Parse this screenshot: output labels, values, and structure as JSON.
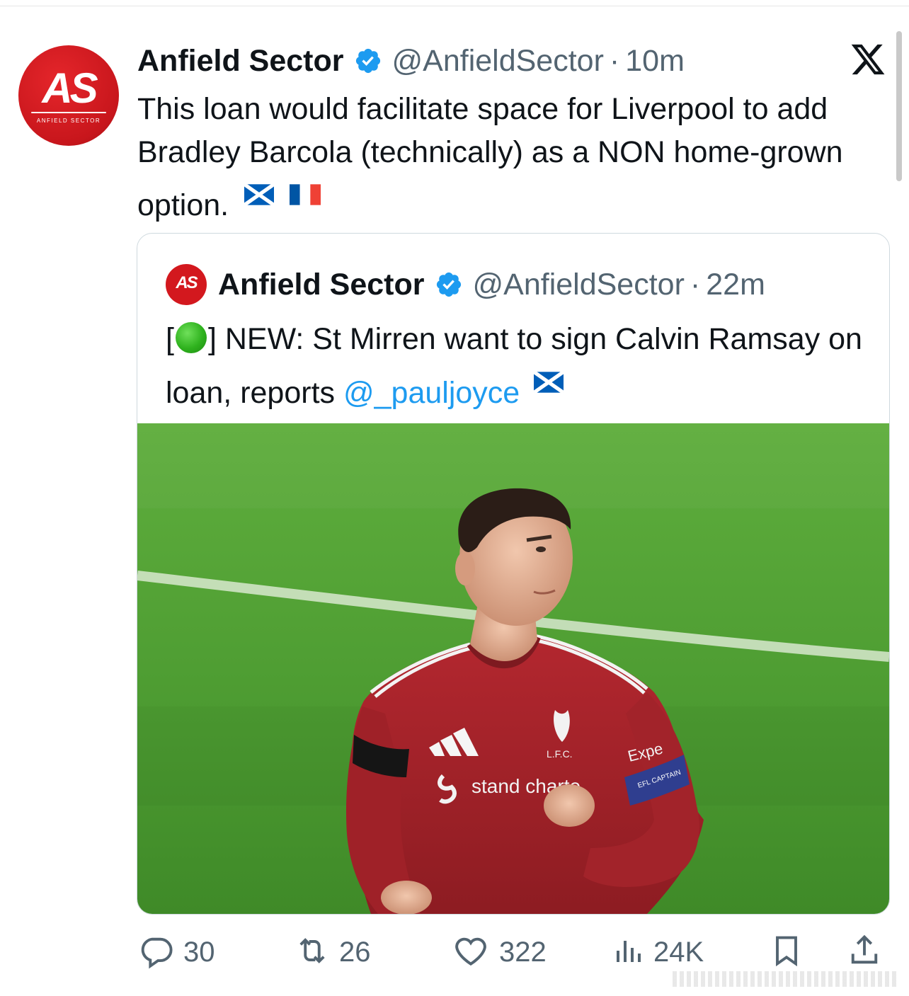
{
  "tweet": {
    "author": {
      "display_name": "Anfield Sector",
      "handle": "@AnfieldSector",
      "avatar_text": "AS",
      "avatar_subtext": "ANFIELD SECTOR"
    },
    "separator": "·",
    "time": "10m",
    "text": "This loan would facilitate space for Liverpool to add Bradley Barcola (technically) as a NON home-grown option.",
    "flags": [
      "scotland-flag",
      "france-flag"
    ]
  },
  "quoted_tweet": {
    "author": {
      "display_name": "Anfield Sector",
      "handle": "@AnfieldSector",
      "avatar_text": "AS"
    },
    "separator": "·",
    "time": "22m",
    "text_prefix_open": "[",
    "text_prefix_close": "] NEW: St Mirren want to sign Calvin Ramsay on loan, reports ",
    "mention": "@_pauljoyce",
    "flag": "scotland-flag",
    "image": {
      "shirt_sponsor": "stand charte",
      "crest_text": "L.F.C.",
      "sleeve_sponsor": "Expe",
      "armband_text": "EFL CAPTAIN"
    }
  },
  "actions": {
    "replies": "30",
    "reposts": "26",
    "likes": "322",
    "views": "24K"
  },
  "colors": {
    "verified": "#1d9bf0",
    "brand_red": "#d3181e",
    "muted_text": "#536471",
    "link": "#1d9bf0",
    "pitch_green": "#4f9e33"
  }
}
